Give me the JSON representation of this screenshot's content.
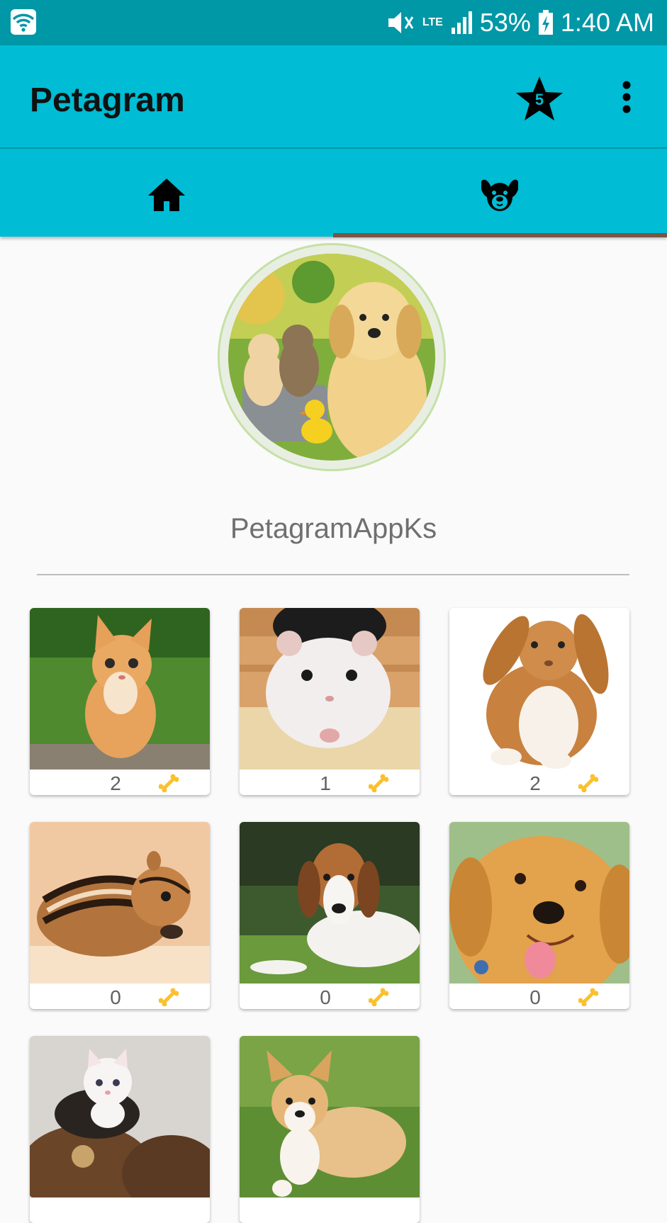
{
  "status_bar": {
    "battery": "53%",
    "time": "1:40 AM",
    "network": "LTE",
    "icons": [
      "wifi-icon",
      "mute-icon",
      "signal-icon",
      "battery-charging-icon"
    ]
  },
  "toolbar": {
    "title": "Petagram",
    "favorites_count": "5",
    "icons": [
      "star-icon",
      "more-vert-icon"
    ]
  },
  "tabs": [
    {
      "icon": "home-icon",
      "selected": false
    },
    {
      "icon": "dog-face-icon",
      "selected": true
    }
  ],
  "colors": {
    "primary": "#00bcd4",
    "primary_dark": "#0097a7",
    "tab_indicator": "#795548",
    "bone": "#fbc02d"
  },
  "profile": {
    "name": "PetagramAppKs",
    "avatar": "kittens-puppy-duck-photo"
  },
  "pets": [
    {
      "photo": "orange-kitten",
      "likes": "2"
    },
    {
      "photo": "white-hamster",
      "likes": "1"
    },
    {
      "photo": "brown-white-bunny",
      "likes": "2"
    },
    {
      "photo": "chipmunk",
      "likes": "0"
    },
    {
      "photo": "beagle",
      "likes": "0"
    },
    {
      "photo": "golden-puppy",
      "likes": "0"
    },
    {
      "photo": "white-kitten-in-shoe",
      "likes": ""
    },
    {
      "photo": "corgi-puppy",
      "likes": ""
    }
  ]
}
